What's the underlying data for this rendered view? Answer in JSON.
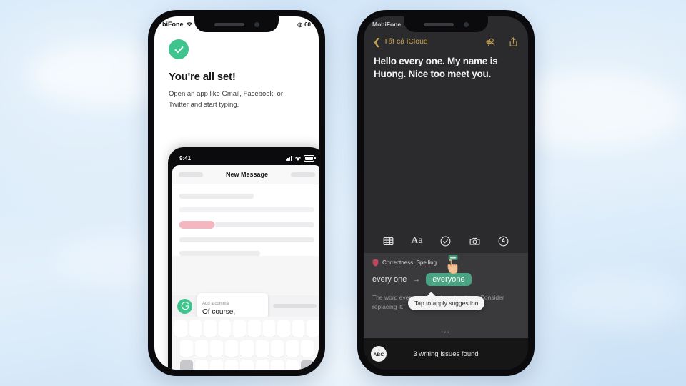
{
  "background": {
    "sky_top": "#cfe4f7",
    "sky_bottom": "#c9e0f5"
  },
  "left_phone": {
    "status_bar": {
      "carrier": "biFone",
      "battery": "60",
      "wifi_icon": "wifi-icon"
    },
    "success": {
      "check_icon": "check-circle-icon",
      "accent_color": "#3ec48d",
      "title": "You're all set!",
      "body": "Open an app like Gmail, Facebook, or Twitter and start typing."
    },
    "inner_phone": {
      "status_bar": {
        "time": "9:41",
        "signal_icon": "cellular-bars-icon",
        "wifi_icon": "wifi-icon",
        "battery_icon": "battery-icon"
      },
      "compose_header": {
        "title": "New Message"
      },
      "grammarly_bar": {
        "logo": "grammarly-g-icon",
        "hint": "Add a comma",
        "suggestion": "Of course,"
      }
    }
  },
  "right_phone": {
    "status_bar": {
      "carrier": "MobiFone"
    },
    "nav": {
      "back_icon": "chevron-left-icon",
      "back_label": "Tất cả iCloud",
      "collaborate_icon": "add-person-icon",
      "share_icon": "share-icon",
      "accent_color": "#c6a44f"
    },
    "note_text": "Hello every one. My name is Huong. Nice too meet you.",
    "toolbar": [
      {
        "name": "table-icon"
      },
      {
        "name": "text-format-icon",
        "label": "Aa"
      },
      {
        "name": "checklist-icon"
      },
      {
        "name": "camera-icon"
      },
      {
        "name": "markup-pen-icon"
      }
    ],
    "grammarly_card": {
      "category_icon": "shield-icon",
      "category": "Correctness: Spelling",
      "original": "every one",
      "arrow": "→",
      "replacement": "everyone",
      "replacement_color": "#4aa383",
      "description": "The word every one may be miswritten. Consider replacing it.",
      "tooltip": "Tap to apply suggestion",
      "cursor_icon": "pointing-hand-icon",
      "pager_dots": "•••"
    },
    "bottom_bar": {
      "keyboard_icon": "abc-keyboard-icon",
      "keyboard_label": "ABC",
      "status": "3 writing issues found"
    }
  }
}
